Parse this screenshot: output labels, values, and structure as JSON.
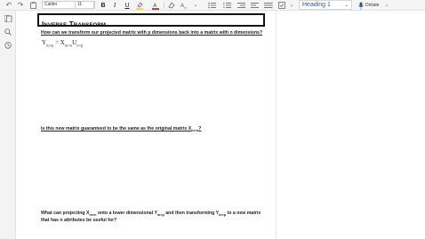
{
  "toolbar": {
    "font_name": "Calibri",
    "font_size": "11",
    "style_value": "Heading 1",
    "dictate_label": "Dictate",
    "colors": {
      "highlight": "#f4d000",
      "font_color": "#c00000",
      "style_text": "#2b579a"
    }
  },
  "page": {
    "title": "Inverse Transform",
    "q1": "How can we transform our projected matrix with p dimensions back into a matrix with n dimensions?",
    "eq": {
      "y": "Y",
      "y_sub": "m×p",
      "eq": " = X",
      "x_sub": "m×n",
      "u": "U",
      "u_sub": "n×p"
    },
    "q2": {
      "text": "Is this new matrix guaranteed to be the same as the original matrix X",
      "sub": "m×n",
      "end": "?"
    },
    "q3": {
      "a": "What can projecting X",
      "a_sub": "m×n",
      "b": " onto a lower dimensional Y",
      "b_sub": "m×p",
      "c": " and then transforming Y",
      "c_sub": "m×p",
      "d": " to a new matrix that has n attributes be useful for?"
    }
  },
  "icons": {
    "undo": "undo-icon",
    "redo": "redo-icon",
    "clipboard": "clipboard-icon",
    "bold": "bold-icon",
    "italic": "italic-icon",
    "underline": "underline-icon",
    "highlight": "highlight-icon",
    "font_color": "font-color-icon",
    "eraser": "clear-format-icon",
    "spelling": "spelling-icon",
    "bullets": "bulleted-list-icon",
    "numbers": "numbered-list-icon",
    "outdent": "decrease-indent-icon",
    "indent": "increase-indent-icon",
    "align": "align-icon",
    "checkbox": "todo-tag-icon",
    "mic": "microphone-icon",
    "pages": "pages-icon",
    "search": "search-icon",
    "recent": "recent-icon"
  }
}
